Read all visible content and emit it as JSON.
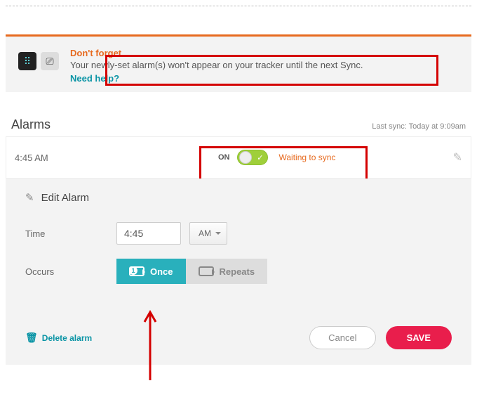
{
  "info": {
    "title": "Don't forget...",
    "message": "Your newly-set alarm(s) won't appear on your tracker until the next Sync.",
    "help_link": "Need help?"
  },
  "alarms": {
    "header": "Alarms",
    "last_sync": "Last sync: Today at 9:09am",
    "rows": [
      {
        "time": "4:45 AM",
        "state_label": "ON",
        "status": "Waiting to sync"
      }
    ]
  },
  "edit": {
    "title": "Edit Alarm",
    "time_label": "Time",
    "time_value": "4:45",
    "ampm_value": "AM",
    "occurs_label": "Occurs",
    "once_label": "Once",
    "repeats_label": "Repeats",
    "delete_label": "Delete alarm",
    "cancel_label": "Cancel",
    "save_label": "SAVE"
  },
  "colors": {
    "accent_orange": "#e76a1f",
    "accent_teal": "#29b0bc",
    "accent_pink": "#e91e4c",
    "highlight_red": "#d40000"
  }
}
